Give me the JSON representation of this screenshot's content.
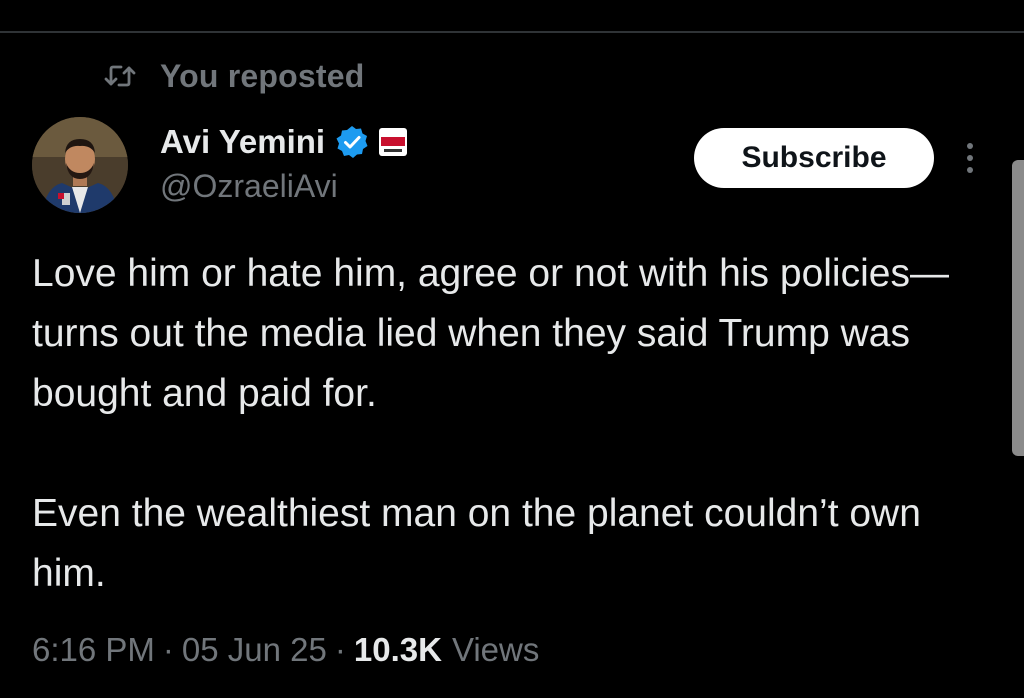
{
  "repost": {
    "label": "You reposted",
    "icon": "repost-icon"
  },
  "author": {
    "name": "Avi Yemini",
    "handle": "@OzraeliAvi",
    "verified": true,
    "verified_color": "#1d9bf0",
    "affiliate_badge": "rebel-news-badge"
  },
  "actions": {
    "subscribe_label": "Subscribe",
    "more_icon": "more-vertical-icon"
  },
  "tweet": {
    "paragraph1": "Love him or hate him, agree or not with his policies—turns out the media lied when they said Trump was bought and paid for.",
    "paragraph2": "Even the wealthiest man on the planet couldn’t own him."
  },
  "meta": {
    "time": "6:16 PM",
    "separator": "·",
    "date": "05 Jun 25",
    "views_count": "10.3K",
    "views_label": "Views"
  },
  "colors": {
    "background": "#000000",
    "text_primary": "#e7e9ea",
    "text_secondary": "#71767b",
    "divider": "#2f3336",
    "button_bg": "#ffffff",
    "button_text": "#0f1419"
  }
}
